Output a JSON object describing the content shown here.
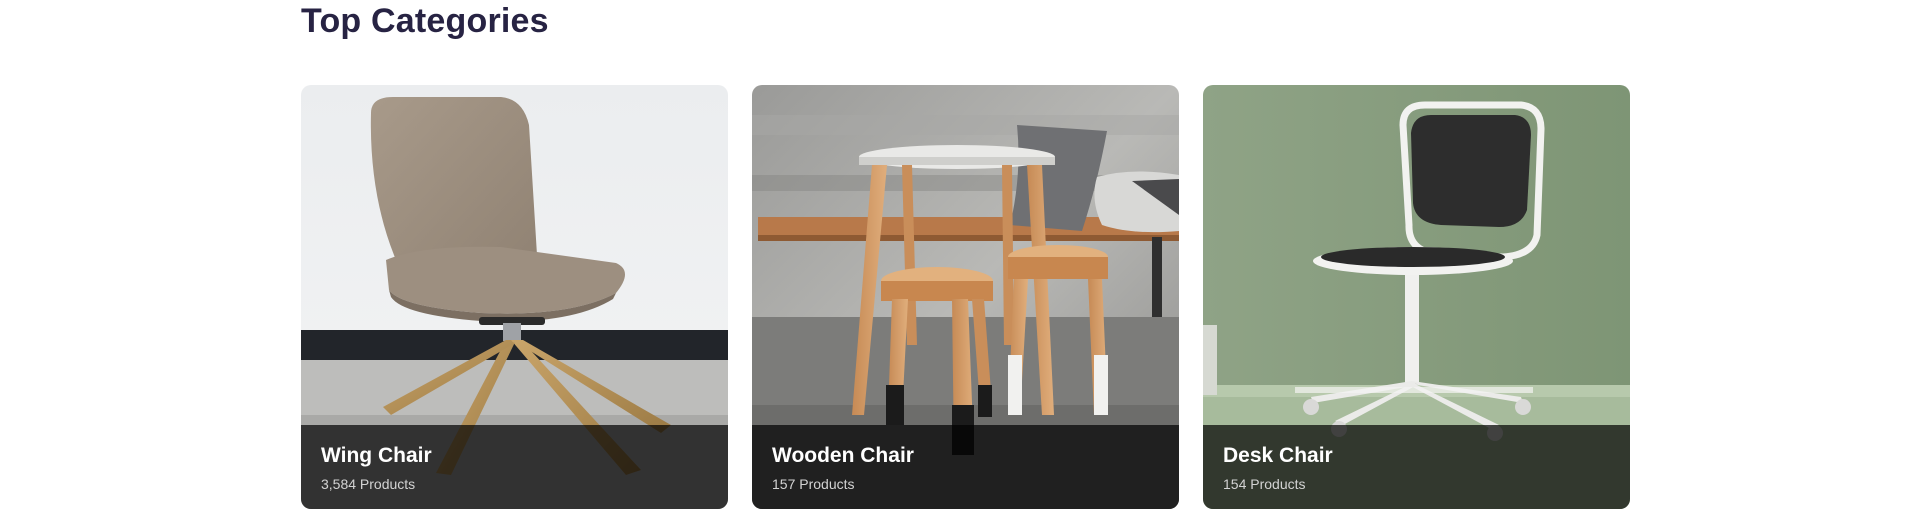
{
  "section": {
    "title": "Top Categories"
  },
  "categories": [
    {
      "name": "Wing Chair",
      "count": "3,584 Products",
      "icon": "wing-chair-image"
    },
    {
      "name": "Wooden Chair",
      "count": "157 Products",
      "icon": "wooden-chair-image"
    },
    {
      "name": "Desk Chair",
      "count": "154 Products",
      "icon": "desk-chair-image"
    }
  ],
  "colors": {
    "title": "#272343",
    "overlay": "rgba(0,0,0,0.70)",
    "card_text": "#ffffff",
    "card_subtext": "#d3d3d3"
  }
}
